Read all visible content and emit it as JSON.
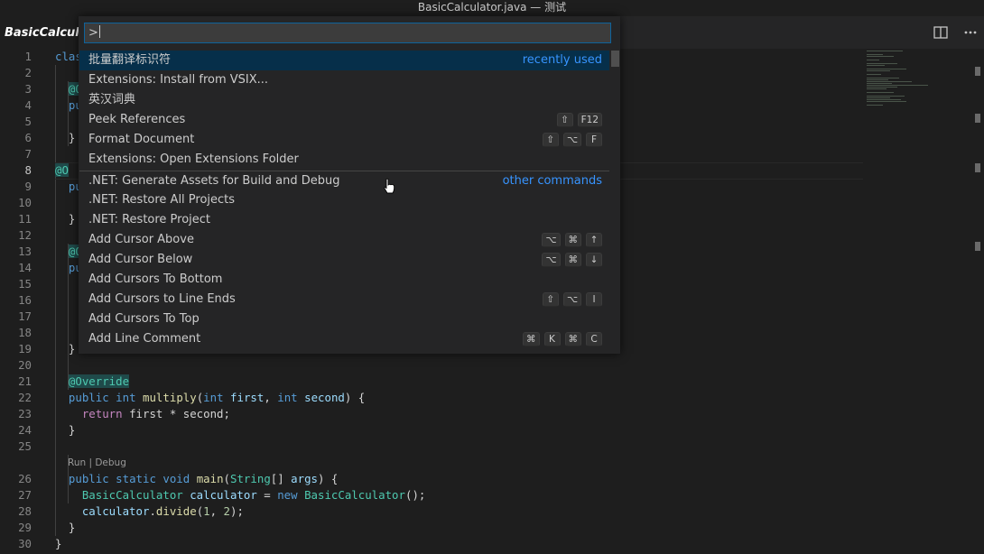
{
  "window": {
    "title": "BasicCalculator.java — 测试"
  },
  "tab": {
    "label": "BasicCalculator.java"
  },
  "toolbar": {
    "split_icon": "split-editor-icon",
    "more_icon": "more-actions-icon"
  },
  "palette": {
    "input_value": ">",
    "items": [
      {
        "label": "批量翻译标识符",
        "tag": "recently used",
        "keys": []
      },
      {
        "label": "Extensions: Install from VSIX...",
        "tag": "",
        "keys": []
      },
      {
        "label": "英汉词典",
        "tag": "",
        "keys": []
      },
      {
        "label": "Peek References",
        "tag": "",
        "keys": [
          "⇧",
          "F12"
        ]
      },
      {
        "label": "Format Document",
        "tag": "",
        "keys": [
          "⇧",
          "⌥",
          "F"
        ]
      },
      {
        "label": "Extensions: Open Extensions Folder",
        "tag": "",
        "keys": []
      },
      {
        "label": ".NET: Generate Assets for Build and Debug",
        "tag": "other commands",
        "keys": []
      },
      {
        "label": ".NET: Restore All Projects",
        "tag": "",
        "keys": []
      },
      {
        "label": ".NET: Restore Project",
        "tag": "",
        "keys": []
      },
      {
        "label": "Add Cursor Above",
        "tag": "",
        "keys": [
          "⌥",
          "⌘",
          "↑"
        ]
      },
      {
        "label": "Add Cursor Below",
        "tag": "",
        "keys": [
          "⌥",
          "⌘",
          "↓"
        ]
      },
      {
        "label": "Add Cursors To Bottom",
        "tag": "",
        "keys": []
      },
      {
        "label": "Add Cursors to Line Ends",
        "tag": "",
        "keys": [
          "⇧",
          "⌥",
          "I"
        ]
      },
      {
        "label": "Add Cursors To Top",
        "tag": "",
        "keys": []
      },
      {
        "label": "Add Line Comment",
        "tag": "",
        "keys": [
          "⌘",
          "K",
          "⌘",
          "C"
        ]
      }
    ]
  },
  "editor": {
    "active_line": 8,
    "codelens": "Run | Debug",
    "lines": [
      {
        "n": "1",
        "tokens": [
          [
            "kw",
            "clas"
          ]
        ]
      },
      {
        "n": "2",
        "tokens": []
      },
      {
        "n": "3",
        "tokens": [
          [
            "pl",
            "  "
          ],
          [
            "an",
            "@O"
          ]
        ]
      },
      {
        "n": "4",
        "tokens": [
          [
            "pl",
            "  "
          ],
          [
            "kw",
            "pu"
          ]
        ]
      },
      {
        "n": "5",
        "tokens": []
      },
      {
        "n": "6",
        "tokens": [
          [
            "pl",
            "  }"
          ]
        ]
      },
      {
        "n": "7",
        "tokens": []
      },
      {
        "n": "8",
        "tokens": [
          [
            "an",
            "@O"
          ]
        ]
      },
      {
        "n": "9",
        "tokens": [
          [
            "pl",
            "  "
          ],
          [
            "kw",
            "pu"
          ]
        ]
      },
      {
        "n": "10",
        "tokens": []
      },
      {
        "n": "11",
        "tokens": [
          [
            "pl",
            "  }"
          ]
        ]
      },
      {
        "n": "12",
        "tokens": []
      },
      {
        "n": "13",
        "tokens": [
          [
            "pl",
            "  "
          ],
          [
            "an",
            "@O"
          ]
        ]
      },
      {
        "n": "14",
        "tokens": [
          [
            "pl",
            "  "
          ],
          [
            "kw",
            "pu"
          ]
        ]
      },
      {
        "n": "15",
        "tokens": []
      },
      {
        "n": "16",
        "tokens": []
      },
      {
        "n": "17",
        "tokens": []
      },
      {
        "n": "18",
        "tokens": []
      },
      {
        "n": "19",
        "tokens": [
          [
            "pl",
            "  }"
          ]
        ]
      },
      {
        "n": "20",
        "tokens": []
      },
      {
        "n": "21",
        "tokens": [
          [
            "pl",
            "  "
          ],
          [
            "an",
            "@Override"
          ]
        ]
      },
      {
        "n": "22",
        "tokens": [
          [
            "pl",
            "  "
          ],
          [
            "kw",
            "public"
          ],
          [
            "pl",
            " "
          ],
          [
            "kw",
            "int"
          ],
          [
            "pl",
            " "
          ],
          [
            "fn",
            "multiply"
          ],
          [
            "pl",
            "("
          ],
          [
            "kw",
            "int"
          ],
          [
            "pl",
            " "
          ],
          [
            "vr",
            "first"
          ],
          [
            "pl",
            ", "
          ],
          [
            "kw",
            "int"
          ],
          [
            "pl",
            " "
          ],
          [
            "vr",
            "second"
          ],
          [
            "pl",
            ") {"
          ]
        ]
      },
      {
        "n": "23",
        "tokens": [
          [
            "pl",
            "    "
          ],
          [
            "kw2",
            "return"
          ],
          [
            "pl",
            " first * second;"
          ]
        ]
      },
      {
        "n": "24",
        "tokens": [
          [
            "pl",
            "  }"
          ]
        ]
      },
      {
        "n": "25",
        "tokens": []
      },
      {
        "n": "26",
        "tokens": [
          [
            "pl",
            "  "
          ],
          [
            "kw",
            "public"
          ],
          [
            "pl",
            " "
          ],
          [
            "kw",
            "static"
          ],
          [
            "pl",
            " "
          ],
          [
            "kw",
            "void"
          ],
          [
            "pl",
            " "
          ],
          [
            "fn",
            "main"
          ],
          [
            "pl",
            "("
          ],
          [
            "ty",
            "String"
          ],
          [
            "pl",
            "[] "
          ],
          [
            "vr",
            "args"
          ],
          [
            "pl",
            ") {"
          ]
        ]
      },
      {
        "n": "27",
        "tokens": [
          [
            "pl",
            "    "
          ],
          [
            "ty",
            "BasicCalculator"
          ],
          [
            "pl",
            " "
          ],
          [
            "vr",
            "calculator"
          ],
          [
            "pl",
            " = "
          ],
          [
            "kw",
            "new"
          ],
          [
            "pl",
            " "
          ],
          [
            "ty",
            "BasicCalculator"
          ],
          [
            "pl",
            "();"
          ]
        ]
      },
      {
        "n": "28",
        "tokens": [
          [
            "pl",
            "    "
          ],
          [
            "vr",
            "calculator"
          ],
          [
            "pl",
            "."
          ],
          [
            "fn",
            "divide"
          ],
          [
            "pl",
            "("
          ],
          [
            "nm",
            "1"
          ],
          [
            "pl",
            ", "
          ],
          [
            "nm",
            "2"
          ],
          [
            "pl",
            ");"
          ]
        ]
      },
      {
        "n": "29",
        "tokens": [
          [
            "pl",
            "  }"
          ]
        ]
      },
      {
        "n": "30",
        "tokens": [
          [
            "pl",
            "}"
          ]
        ]
      }
    ]
  }
}
